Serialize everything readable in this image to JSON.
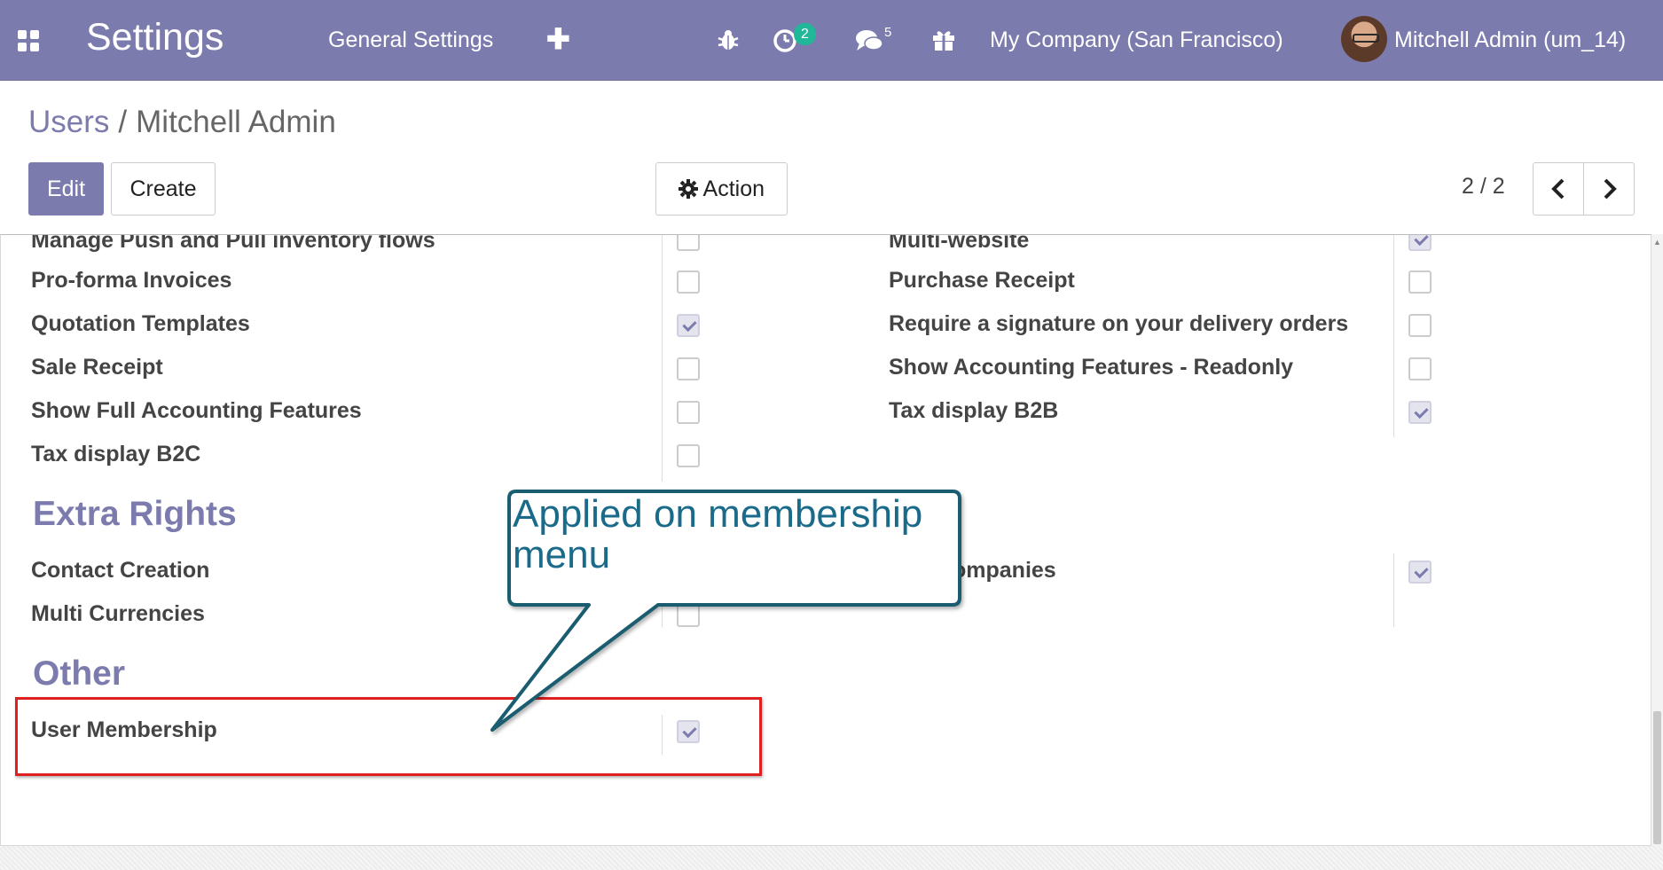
{
  "navbar": {
    "app_name": "Settings",
    "menu_item": "General Settings",
    "plus": "✚",
    "activity_count": "2",
    "messages_count": "5",
    "company": "My Company (San Francisco)",
    "user": "Mitchell Admin (um_14)"
  },
  "breadcrumb": {
    "parent": "Users",
    "separator": "/",
    "current": "Mitchell Admin"
  },
  "toolbar": {
    "edit_label": "Edit",
    "create_label": "Create",
    "action_label": "Action",
    "pager_value": "2 / 2",
    "prev": "‹",
    "next": "›"
  },
  "technical_settings": {
    "left": [
      {
        "label": "Manage Push and Pull inventory flows",
        "checked": false
      },
      {
        "label": "Pro-forma Invoices",
        "checked": false
      },
      {
        "label": "Quotation Templates",
        "checked": true
      },
      {
        "label": "Sale Receipt",
        "checked": false
      },
      {
        "label": "Show Full Accounting Features",
        "checked": false
      },
      {
        "label": "Tax display B2C",
        "checked": false
      }
    ],
    "right": [
      {
        "label": "Multi-website",
        "checked": true
      },
      {
        "label": "Purchase Receipt",
        "checked": false
      },
      {
        "label": "Require a signature on your delivery orders",
        "checked": false
      },
      {
        "label": "Show Accounting Features - Readonly",
        "checked": false
      },
      {
        "label": "Tax display B2B",
        "checked": true
      }
    ]
  },
  "extra_rights": {
    "title": "Extra Rights",
    "left": [
      {
        "label": "Contact Creation",
        "checked": false
      },
      {
        "label": "Multi Currencies",
        "checked": false
      }
    ],
    "right": [
      {
        "label": "Multi Companies",
        "visible_label": "ompanies",
        "checked": true
      }
    ]
  },
  "other": {
    "title": "Other",
    "items": [
      {
        "label": "User Membership",
        "checked": true
      }
    ]
  },
  "annotation": {
    "callout_text": "Applied on membership menu",
    "highlight_color": "#e02020",
    "callout_border": "#1a5c70",
    "callout_text_color": "#1a6a8a"
  },
  "colors": {
    "brand": "#7c7bad",
    "badge": "#21b799"
  }
}
